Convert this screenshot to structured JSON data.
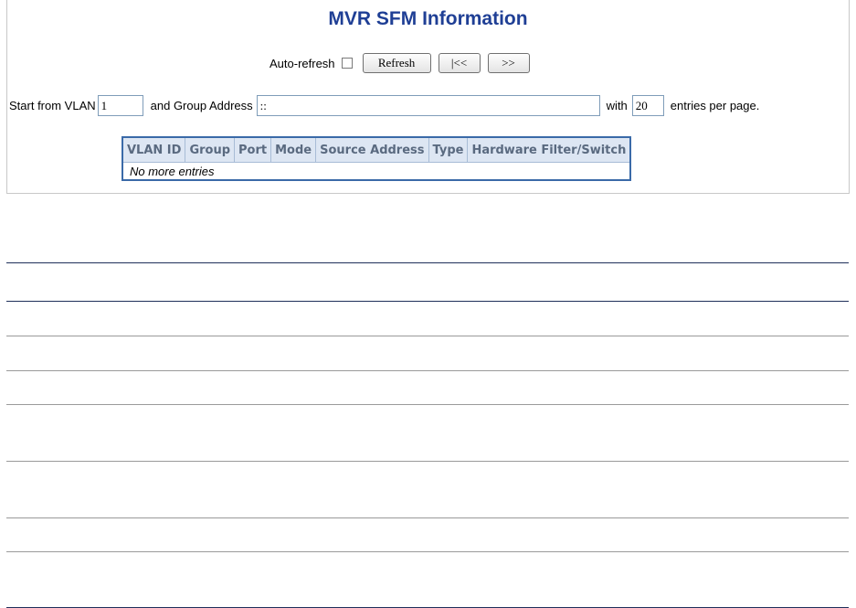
{
  "title": "MVR SFM Information",
  "refresh": {
    "auto_refresh_label": "Auto-refresh",
    "refresh_label": "Refresh",
    "prev_label": "|<<",
    "next_label": ">>"
  },
  "filter": {
    "start_label": "Start from VLAN",
    "vlan_value": "1",
    "group_label": "and Group Address",
    "group_value": "::",
    "with_label": "with",
    "entries_value": "20",
    "entries_suffix": "entries per page."
  },
  "table": {
    "headers": [
      "VLAN ID",
      "Group",
      "Port",
      "Mode",
      "Source Address",
      "Type",
      "Hardware Filter/Switch"
    ],
    "empty_message": "No more entries"
  }
}
